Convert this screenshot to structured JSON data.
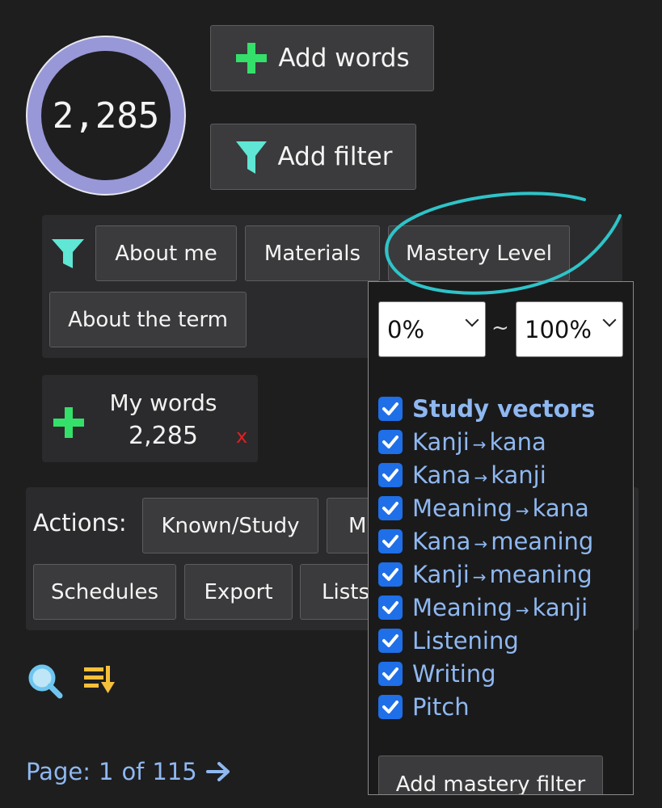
{
  "counter": {
    "value": "2,285"
  },
  "toolbar": {
    "add_words_label": "Add words",
    "add_filter_label": "Add filter"
  },
  "filter_tabs": [
    {
      "label": "About me"
    },
    {
      "label": "Materials"
    },
    {
      "label": "Mastery Level"
    },
    {
      "label": "About the term"
    }
  ],
  "word_list": {
    "title": "My words",
    "count": "2,285",
    "remove_label": "x"
  },
  "actions": {
    "label": "Actions:",
    "buttons": [
      "Known/Study",
      "M",
      "Schedules",
      "Export",
      "Lists"
    ]
  },
  "mastery": {
    "min_value": "0%",
    "separator": "~",
    "max_value": "100%",
    "group_label": "Study vectors",
    "vectors": [
      {
        "from": "Kanji",
        "to": "kana",
        "checked": true
      },
      {
        "from": "Kana",
        "to": "kanji",
        "checked": true
      },
      {
        "from": "Meaning",
        "to": "kana",
        "checked": true
      },
      {
        "from": "Kana",
        "to": "meaning",
        "checked": true
      },
      {
        "from": "Kanji",
        "to": "meaning",
        "checked": true
      },
      {
        "from": "Meaning",
        "to": "kanji",
        "checked": true
      },
      {
        "label": "Listening",
        "checked": true
      },
      {
        "label": "Writing",
        "checked": true
      },
      {
        "label": "Pitch",
        "checked": true
      }
    ],
    "add_label": "Add mastery filter"
  },
  "pagination": {
    "prefix": "Page:",
    "current": "1",
    "of": "of",
    "total": "115"
  },
  "colors": {
    "accent_green": "#34e06a",
    "accent_teal": "#5fe6d4",
    "ring": "#9898d8",
    "checkbox": "#1f6fe8",
    "link": "#8fb8f0",
    "remove": "#e02020",
    "sort_icon": "#f5c03a",
    "search_icon": "#6ec6f0",
    "annotation": "#2ec4c8"
  },
  "icons": {
    "add": "plus-icon",
    "filter": "filter-funnel-icon",
    "search": "magnifier-icon",
    "sort": "sort-descending-icon",
    "next": "arrow-right-icon"
  }
}
